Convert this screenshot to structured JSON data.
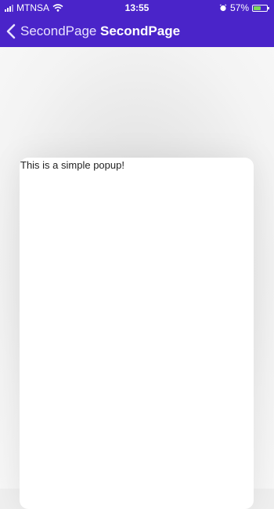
{
  "status_bar": {
    "carrier": "MTNSA",
    "time": "13:55",
    "battery_percent": "57%",
    "battery_level": 0.57,
    "icons": [
      "signal-icon",
      "wifi-icon",
      "alarm-icon",
      "battery-icon"
    ],
    "colors": {
      "bar": "#4a24c9",
      "battery_fill": "#7ed957"
    }
  },
  "nav": {
    "back_label": "SecondPage",
    "title": "SecondPage",
    "icons": [
      "chevron-left-icon"
    ]
  },
  "popup": {
    "text": "This is a simple popup!"
  }
}
